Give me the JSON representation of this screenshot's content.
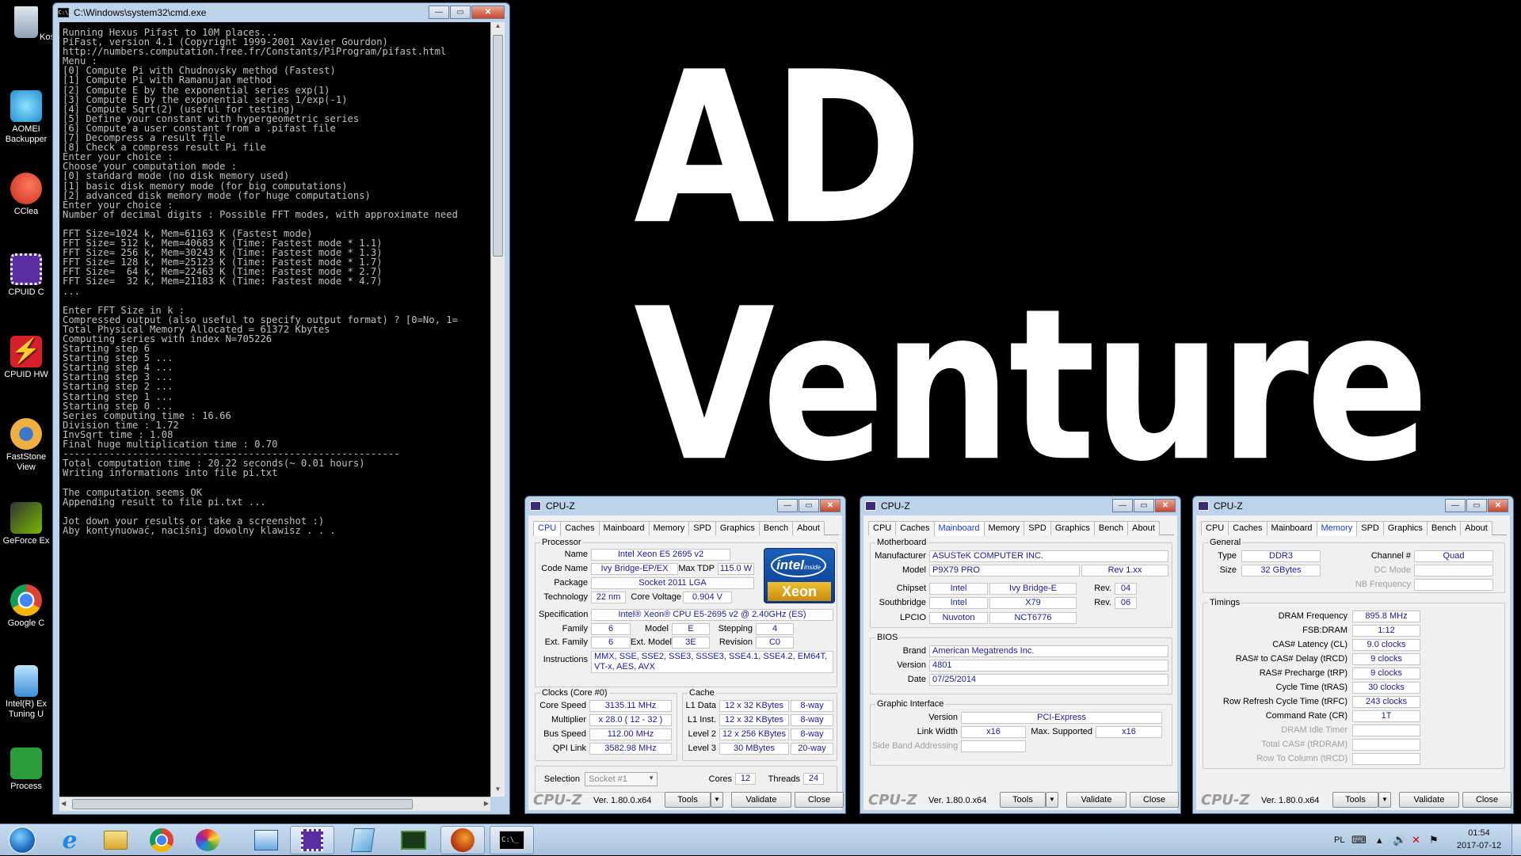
{
  "desktop": {
    "icons": [
      {
        "label": "Kos",
        "icon": "recycle-bin-icon",
        "color": "#8fa3b8"
      },
      {
        "label": "AOMEI Backupper Standard",
        "icon": "aomei-icon",
        "color": "#2aa8e0"
      },
      {
        "label": "CClea",
        "icon": "ccleaner-icon",
        "color": "#d23c2a"
      },
      {
        "label": "CPUID C",
        "icon": "cpuid-icon",
        "color": "#5a2da0"
      },
      {
        "label": "CPUID HW",
        "icon": "hwmonitor-icon",
        "color": "#d8202a"
      },
      {
        "label": "FastStone View",
        "icon": "faststone-icon",
        "color": "#e0a030"
      },
      {
        "label": "GeForce Ex",
        "icon": "geforce-icon",
        "color": "#76b900"
      },
      {
        "label": "Google C",
        "icon": "chrome-icon",
        "color": "#db4437"
      },
      {
        "label": "Intel(R) Ex Tuning U",
        "icon": "intel-xtu-icon",
        "color": "#3a8fd8"
      },
      {
        "label": "Process",
        "icon": "process-icon",
        "color": "#2c9c3c"
      }
    ]
  },
  "wallpaper": {
    "logo_text": "AD Venture"
  },
  "cmd": {
    "title": "C:\\Windows\\system32\\cmd.exe",
    "output": "Running Hexus Pifast to 10M places...\nPiFast, version 4.1 (Copyright 1999-2001 Xavier Gourdon)\nhttp://numbers.computation.free.fr/Constants/PiProgram/pifast.html\nMenu :\n[0] Compute Pi with Chudnovsky method (Fastest)\n[1] Compute Pi with Ramanujan method\n[2] Compute E by the exponential series exp(1)\n[3] Compute E by the exponential series 1/exp(-1)\n[4] Compute Sqrt(2) (useful for testing)\n[5] Define your constant with hypergeometric series\n[6] Compute a user constant from a .pifast file\n[7] Decompress a result file\n[8] Check a compress result Pi file\nEnter your choice :\nChoose your computation mode :\n[0] standard mode (no disk memory used)\n[1] basic disk memory mode (for big computations)\n[2] advanced disk memory mode (for huge computations)\nEnter your choice :\nNumber of decimal digits : Possible FFT modes, with approximate need\n\nFFT Size=1024 k, Mem=61163 K (Fastest mode)\nFFT Size= 512 k, Mem=40683 K (Time: Fastest mode * 1.1)\nFFT Size= 256 k, Mem=30243 K (Time: Fastest mode * 1.3)\nFFT Size= 128 k, Mem=25123 K (Time: Fastest mode * 1.7)\nFFT Size=  64 k, Mem=22463 K (Time: Fastest mode * 2.7)\nFFT Size=  32 k, Mem=21183 K (Time: Fastest mode * 4.7)\n...\n\nEnter FFT Size in k :\nCompressed output (also useful to specify output format) ? [0=No, 1=\nTotal Physical Memory Allocated = 61372 Kbytes\nComputing series with index N=705226\nStarting step 6\nStarting step 5 ...\nStarting step 4 ...\nStarting step 3 ...\nStarting step 2 ...\nStarting step 1 ...\nStarting step 0 ...\nSeries computing time : 16.66\nDivision time : 1.72\nInvSqrt time : 1.08\nFinal huge multiplication time : 0.70\n----------------------------------------------------------\nTotal computation time : 20.22 seconds(~ 0.01 hours)\nWriting informations into file pi.txt\n\nThe computation seems OK\nAppending result to file pi.txt ...\n\nJot down your results or take a screenshot :)\nAby kontynuować, naciśnij dowolny klawisz . . ."
  },
  "cpuz_common": {
    "title": "CPU-Z",
    "tabs": [
      "CPU",
      "Caches",
      "Mainboard",
      "Memory",
      "SPD",
      "Graphics",
      "Bench",
      "About"
    ],
    "logo": "CPU-Z",
    "version": "Ver. 1.80.0.x64",
    "tools": "Tools",
    "validate": "Validate",
    "close": "Close"
  },
  "cpu": {
    "processor_title": "Processor",
    "name_label": "Name",
    "name": "Intel Xeon E5 2695 v2",
    "codename_label": "Code Name",
    "codename": "Ivy Bridge-EP/EX",
    "maxtdp_label": "Max TDP",
    "maxtdp": "115.0 W",
    "package_label": "Package",
    "package": "Socket 2011 LGA",
    "technology_label": "Technology",
    "technology": "22 nm",
    "corevoltage_label": "Core Voltage",
    "corevoltage": "0.904 V",
    "spec_label": "Specification",
    "spec": "Intel® Xeon® CPU E5-2695 v2 @ 2.40GHz (ES)",
    "family_label": "Family",
    "family": "6",
    "model_label": "Model",
    "model": "E",
    "stepping_label": "Stepping",
    "stepping": "4",
    "extfamily_label": "Ext. Family",
    "extfamily": "6",
    "extmodel_label": "Ext. Model",
    "extmodel": "3E",
    "revision_label": "Revision",
    "revision": "C0",
    "instructions_label": "Instructions",
    "instructions": "MMX, SSE, SSE2, SSE3, SSSE3, SSE4.1, SSE4.2, EM64T, VT-x, AES, AVX",
    "badge_top": "intel",
    "badge_inside": "inside",
    "badge_brand": "Xeon",
    "clocks_title": "Clocks (Core #0)",
    "corespeed_label": "Core Speed",
    "corespeed": "3135.11 MHz",
    "multiplier_label": "Multiplier",
    "multiplier": "x 28.0 ( 12 - 32 )",
    "busspeed_label": "Bus Speed",
    "busspeed": "112.00 MHz",
    "qpi_label": "QPI Link",
    "qpi": "3582.98 MHz",
    "cache_title": "Cache",
    "l1d_label": "L1 Data",
    "l1d": "12 x 32 KBytes",
    "l1d_way": "8-way",
    "l1i_label": "L1 Inst.",
    "l1i": "12 x 32 KBytes",
    "l1i_way": "8-way",
    "l2_label": "Level 2",
    "l2": "12 x 256 KBytes",
    "l2_way": "8-way",
    "l3_label": "Level 3",
    "l3": "30 MBytes",
    "l3_way": "20-way",
    "selection_label": "Selection",
    "selection": "Socket #1",
    "cores_label": "Cores",
    "cores": "12",
    "threads_label": "Threads",
    "threads": "24"
  },
  "mainboard": {
    "mb_title": "Motherboard",
    "manufacturer_label": "Manufacturer",
    "manufacturer": "ASUSTeK COMPUTER INC.",
    "model_label": "Model",
    "model": "P9X79 PRO",
    "model_rev": "Rev 1.xx",
    "chipset_label": "Chipset",
    "chipset_vendor": "Intel",
    "chipset": "Ivy Bridge-E",
    "chipset_rev_label": "Rev.",
    "chipset_rev": "04",
    "southbridge_label": "Southbridge",
    "sb_vendor": "Intel",
    "sb": "X79",
    "sb_rev_label": "Rev.",
    "sb_rev": "06",
    "lpcio_label": "LPCIO",
    "lpcio_vendor": "Nuvoton",
    "lpcio": "NCT6776",
    "bios_title": "BIOS",
    "brand_label": "Brand",
    "brand": "American Megatrends Inc.",
    "version_label": "Version",
    "version": "4801",
    "date_label": "Date",
    "date": "07/25/2014",
    "gi_title": "Graphic Interface",
    "gi_version_label": "Version",
    "gi_version": "PCI-Express",
    "linkwidth_label": "Link Width",
    "linkwidth": "x16",
    "maxsupported_label": "Max. Supported",
    "maxsupported": "x16",
    "sideband_label": "Side Band Addressing"
  },
  "memory": {
    "general_title": "General",
    "type_label": "Type",
    "type": "DDR3",
    "size_label": "Size",
    "size": "32 GBytes",
    "channel_label": "Channel #",
    "channel": "Quad",
    "dcmode_label": "DC Mode",
    "nbfreq_label": "NB Frequency",
    "timings_title": "Timings",
    "dramfreq_label": "DRAM Frequency",
    "dramfreq": "895.8 MHz",
    "fsbdram_label": "FSB:DRAM",
    "fsbdram": "1:12",
    "cl_label": "CAS# Latency (CL)",
    "cl": "9.0 clocks",
    "trcd_label": "RAS# to CAS# Delay (tRCD)",
    "trcd": "9 clocks",
    "trp_label": "RAS# Precharge (tRP)",
    "trp": "9 clocks",
    "tras_label": "Cycle Time (tRAS)",
    "tras": "30 clocks",
    "trfc_label": "Row Refresh Cycle Time (tRFC)",
    "trfc": "243 clocks",
    "cr_label": "Command Rate (CR)",
    "cr": "1T",
    "idle_label": "DRAM Idle Timer",
    "trdram_label": "Total CAS# (tRDRAM)",
    "trcd2_label": "Row To Column (tRCD)"
  },
  "taskbar": {
    "apps": [
      {
        "icon": "start-orb-icon"
      },
      {
        "icon": "internet-explorer-icon"
      },
      {
        "icon": "file-explorer-icon"
      },
      {
        "icon": "chrome-icon"
      },
      {
        "icon": "paint-icon"
      },
      {
        "icon": "control-panel-icon"
      },
      {
        "icon": "cpuz-icon"
      },
      {
        "icon": "notepad-icon"
      },
      {
        "icon": "gpu-tool-icon"
      },
      {
        "icon": "firefox-icon"
      },
      {
        "icon": "cmd-icon"
      }
    ],
    "lang": "PL",
    "time": "01:54",
    "date": "2017-07-12"
  }
}
